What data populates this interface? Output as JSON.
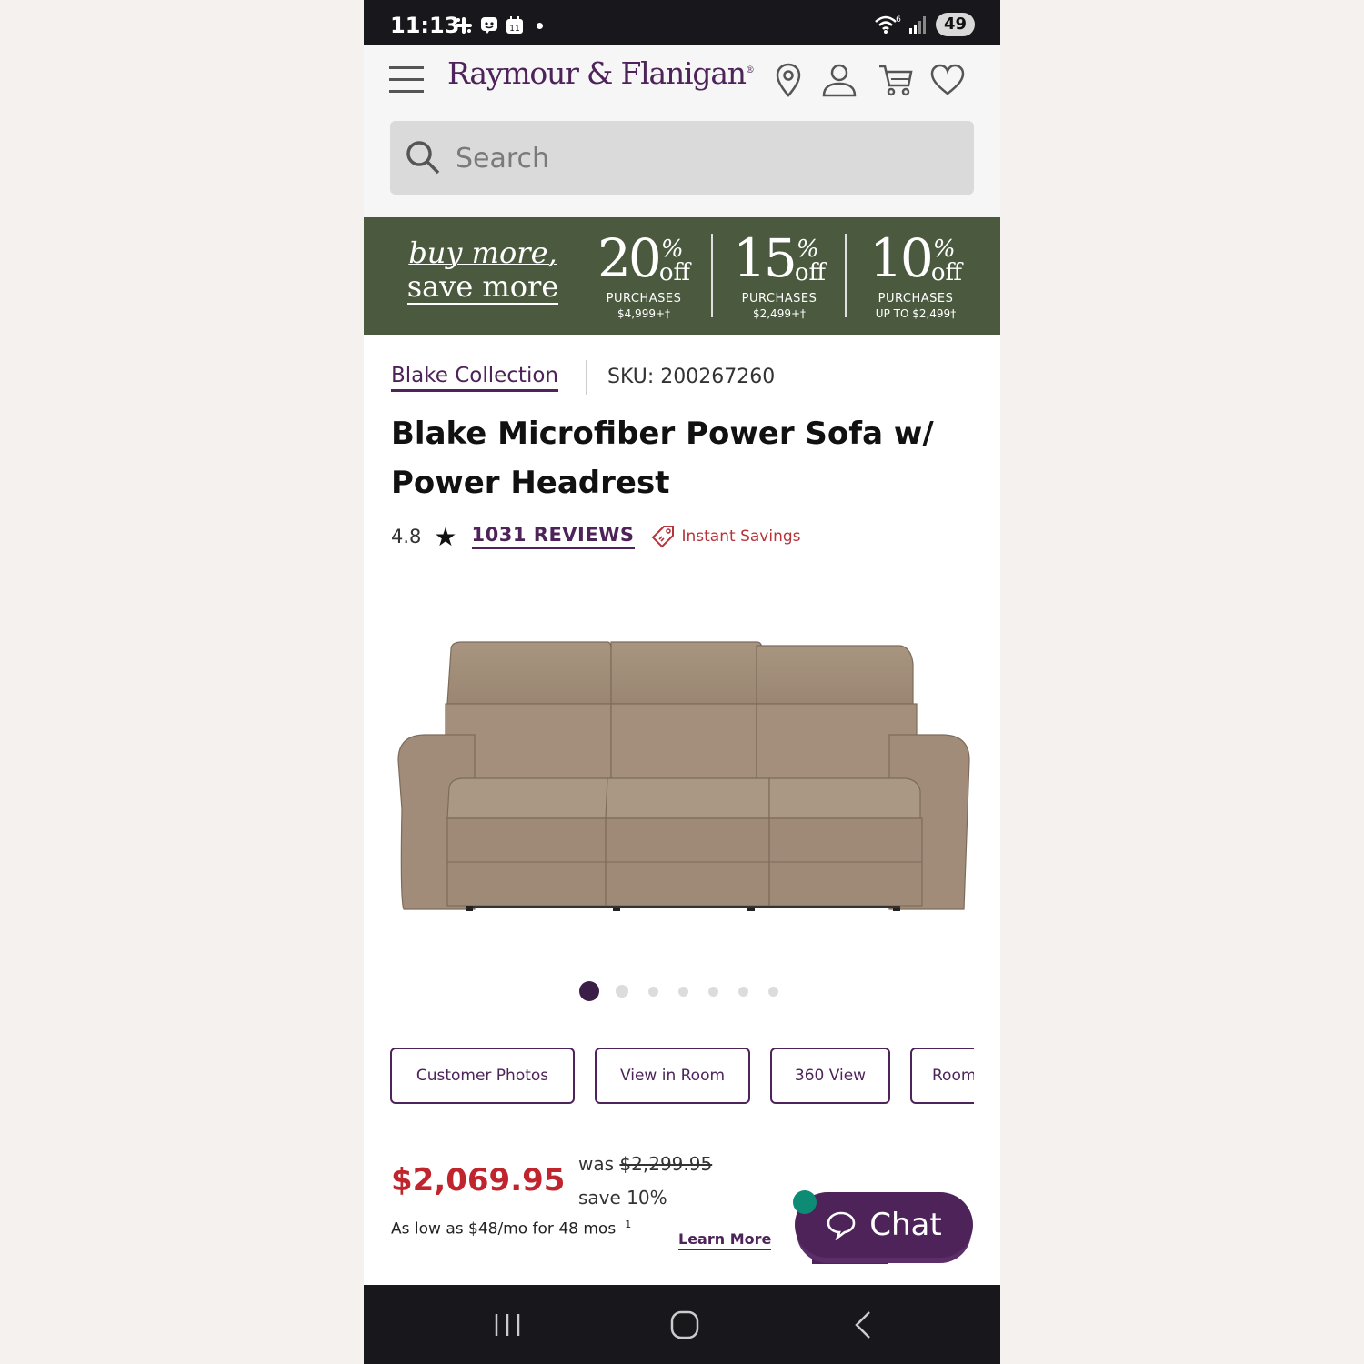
{
  "status_bar": {
    "time": "11:13",
    "calendar_day": "11",
    "network": "6",
    "battery": "49"
  },
  "header": {
    "logo_text": "Raymour & Flanigan",
    "logo_mark": "®",
    "search_placeholder": "Search"
  },
  "promo": {
    "tagline_line1": "buy more,",
    "tagline_line2": "save more",
    "percent_symbol": "%",
    "off_text": "off",
    "offers": [
      {
        "percent": "20",
        "label": "PURCHASES",
        "amount": "$4,999+‡"
      },
      {
        "percent": "15",
        "label": "PURCHASES",
        "amount": "$2,499+‡"
      },
      {
        "percent": "10",
        "label": "PURCHASES",
        "amount": "UP TO $2,499‡"
      }
    ]
  },
  "product": {
    "collection": "Blake Collection",
    "sku": "SKU: 200267260",
    "title": "Blake Microfiber Power Sofa w/ Power Headrest",
    "rating": "4.8",
    "reviews_label": "1031 REVIEWS",
    "instant_savings": "Instant Savings",
    "carousel": {
      "total": 7,
      "active_index": 0
    },
    "media_buttons": [
      "Customer Photos",
      "View in Room",
      "360 View",
      "Room"
    ],
    "price": "$2,069.95",
    "was_label": "was",
    "was_price": "$2,299.95",
    "save_label": "save 10%",
    "finance_text": "As low as $48/mo for 48 mos",
    "finance_footnote": "1",
    "learn_more": "Learn More"
  },
  "chat": {
    "label": "Chat"
  },
  "colors": {
    "brand_purple": "#4d2359",
    "promo_green": "#4b5a3f",
    "price_red": "#c0252e",
    "chat_status_green": "#0d8b75"
  },
  "icons": [
    "menu-icon",
    "location-pin-icon",
    "account-icon",
    "cart-icon",
    "heart-icon",
    "search-icon",
    "star-icon",
    "price-tag-icon",
    "chat-bubble-icon",
    "recent-apps-icon",
    "home-icon",
    "back-icon"
  ]
}
